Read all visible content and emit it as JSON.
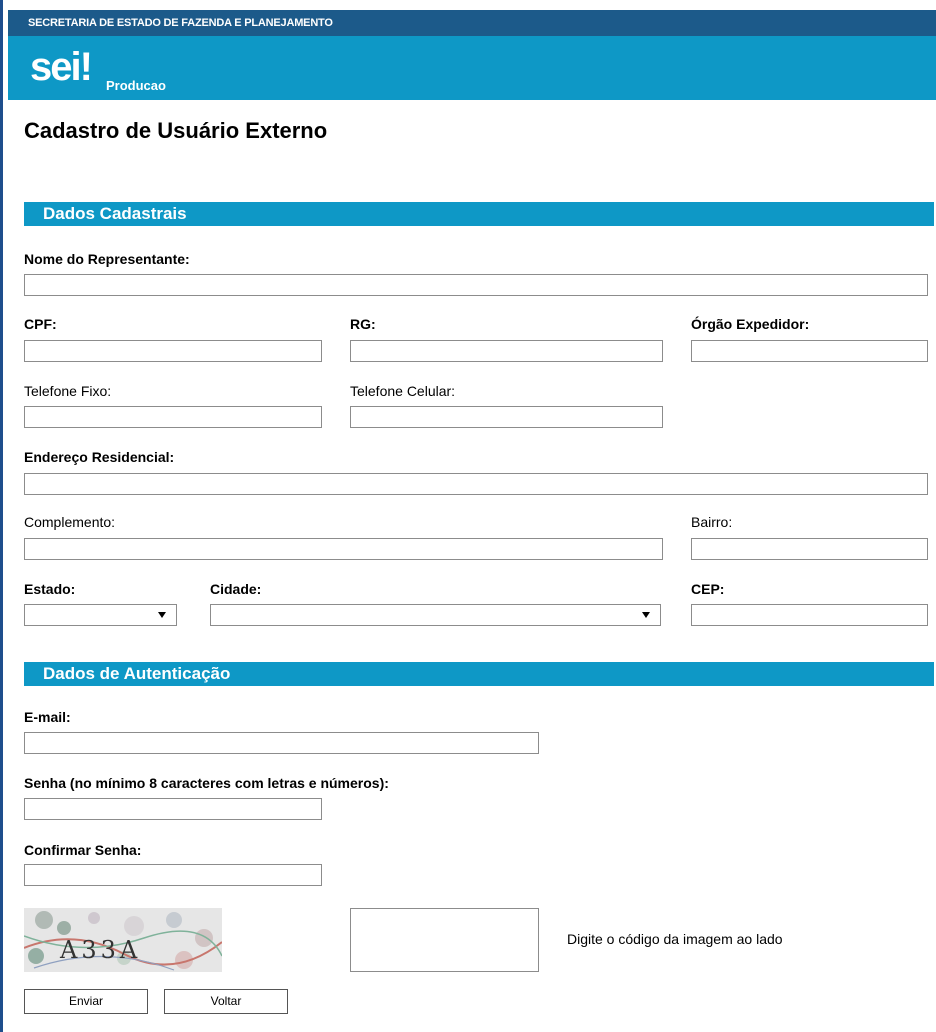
{
  "header": {
    "org": "SECRETARIA DE ESTADO DE FAZENDA E PLANEJAMENTO",
    "logo_text": "sei",
    "logo_mark": "!",
    "environment": "Producao"
  },
  "page_title": "Cadastro de Usuário Externo",
  "sections": {
    "dados_cadastrais": "Dados Cadastrais",
    "dados_autenticacao": "Dados de Autenticação"
  },
  "fields": {
    "nome_representante": "Nome do Representante:",
    "cpf": "CPF:",
    "rg": "RG:",
    "orgao_expedidor": "Órgão Expedidor:",
    "telefone_fixo": "Telefone Fixo:",
    "telefone_celular": "Telefone Celular:",
    "endereco_residencial": "Endereço Residencial:",
    "complemento": "Complemento:",
    "bairro": "Bairro:",
    "estado": "Estado:",
    "cidade": "Cidade:",
    "cep": "CEP:",
    "email": "E-mail:",
    "senha": "Senha (no mínimo 8 caracteres com letras e números):",
    "confirmar_senha": "Confirmar Senha:"
  },
  "captcha": {
    "code_image_text": "A33A",
    "hint": "Digite o código da imagem ao lado"
  },
  "buttons": {
    "enviar": "Enviar",
    "voltar": "Voltar"
  },
  "colors": {
    "top_bar": "#1c5a8a",
    "brand_bar": "#0e98c6",
    "section_bar": "#0e98c6"
  }
}
